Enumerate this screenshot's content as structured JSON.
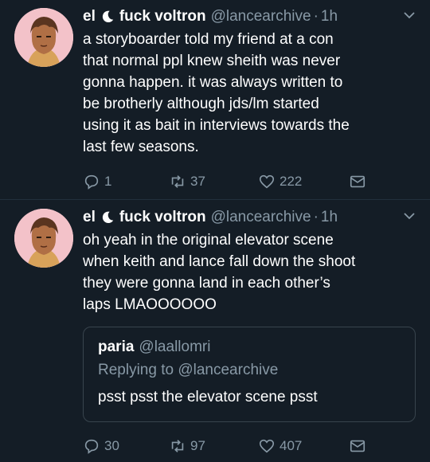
{
  "colors": {
    "background": "#141d26",
    "text": "#ffffff",
    "muted": "#8899a6",
    "border": "#38444d"
  },
  "tweets": [
    {
      "name": "el",
      "name_suffix": "fuck voltron",
      "handle": "@lancearchive",
      "dot": "·",
      "time": "1h",
      "text": "a storyboarder told my friend at a con\nthat normal ppl knew sheith was never\ngonna happen. it was always written to\nbe brotherly although jds/lm started\nusing it as bait in interviews towards the\nlast few seasons.",
      "reply_count": "1",
      "retweet_count": "37",
      "like_count": "222",
      "icons": [
        "moon-icon",
        "chevron-down-icon",
        "reply-icon",
        "retweet-icon",
        "heart-icon",
        "message-icon"
      ]
    },
    {
      "name": "el",
      "name_suffix": "fuck voltron",
      "handle": "@lancearchive",
      "dot": "·",
      "time": "1h",
      "text": "oh yeah in the original elevator scene\nwhen keith and lance fall down the shoot\nthey were gonna land in each other’s\nlaps LMAOOOOOO",
      "reply_count": "30",
      "retweet_count": "97",
      "like_count": "407",
      "quote": {
        "name": "paria",
        "handle": "@laallomri",
        "replying_prefix": "Replying to",
        "replying_to": "@lancearchive",
        "text": "psst psst the elevator scene psst"
      }
    }
  ]
}
